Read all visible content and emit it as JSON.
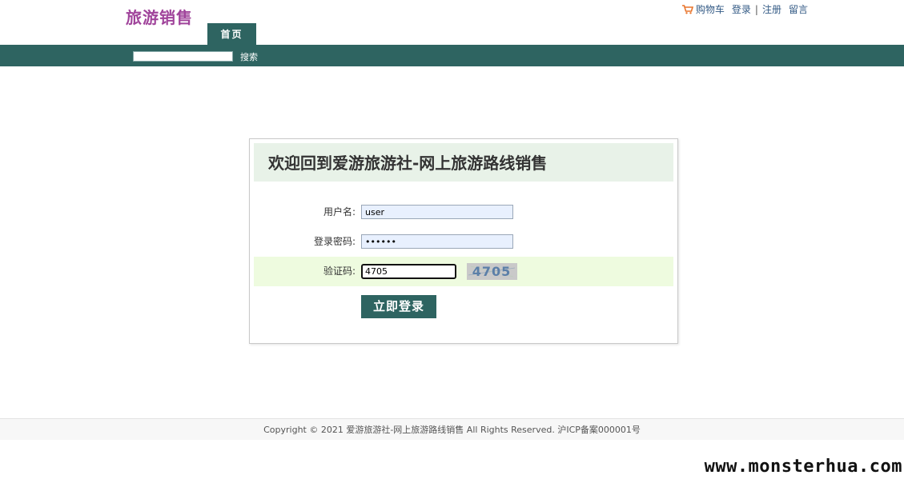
{
  "header": {
    "site_title": "旅游销售",
    "links": {
      "cart": "购物车",
      "login": "登录",
      "separator": "|",
      "register": "注册",
      "guestbook": "留言"
    }
  },
  "nav": {
    "home_tab": "首页"
  },
  "search": {
    "value": "",
    "button_label": "搜索"
  },
  "login": {
    "heading": "欢迎回到爱游旅游社-网上旅游路线销售",
    "username_label": "用户名:",
    "username_value": "user",
    "password_label": "登录密码:",
    "password_value": "••••••",
    "captcha_label": "验证码:",
    "captcha_value": "4705",
    "captcha_image_text": "4705",
    "submit_label": "立即登录"
  },
  "footer": {
    "copyright": "Copyright © 2021 爱游旅游社-网上旅游路线销售 All Rights Reserved. 沪ICP备案000001号"
  },
  "watermark": "www.monsterhua.com",
  "colors": {
    "brand": "#a0449b",
    "nav": "#2e6461",
    "header_bg": "#e8f2e8",
    "captcha_row_bg": "#eefbdf",
    "cart_icon": "#e8742b"
  },
  "icons": {
    "cart": "shopping-cart-icon"
  }
}
